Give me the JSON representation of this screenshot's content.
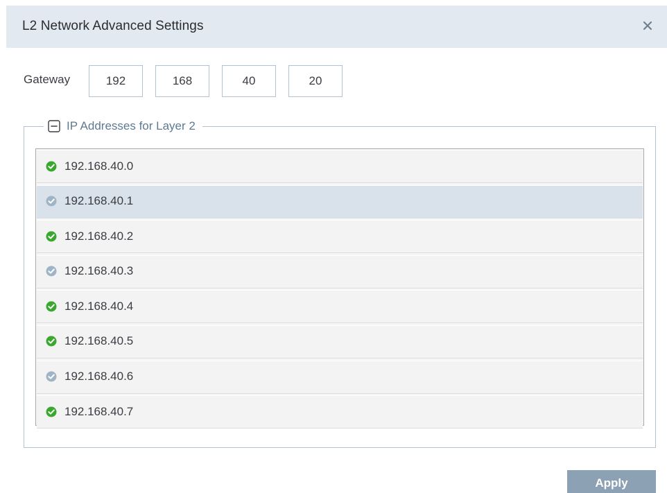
{
  "dialog": {
    "title": "L2 Network Advanced Settings",
    "close_icon": "close-icon"
  },
  "gateway": {
    "label": "Gateway",
    "octets": [
      "192",
      "168",
      "40",
      "20"
    ]
  },
  "ip_group": {
    "legend": "IP Addresses for Layer 2",
    "toggle_icon": "collapse-minus-icon",
    "items": [
      {
        "ip": "192.168.40.0",
        "status": "active",
        "status_color": "#3aa72f",
        "selected": false
      },
      {
        "ip": "192.168.40.1",
        "status": "inactive",
        "status_color": "#9fb4c6",
        "selected": true
      },
      {
        "ip": "192.168.40.2",
        "status": "active",
        "status_color": "#3aa72f",
        "selected": false
      },
      {
        "ip": "192.168.40.3",
        "status": "inactive",
        "status_color": "#9fb4c6",
        "selected": false
      },
      {
        "ip": "192.168.40.4",
        "status": "active",
        "status_color": "#3aa72f",
        "selected": false
      },
      {
        "ip": "192.168.40.5",
        "status": "active",
        "status_color": "#3aa72f",
        "selected": false
      },
      {
        "ip": "192.168.40.6",
        "status": "inactive",
        "status_color": "#9fb4c6",
        "selected": false
      },
      {
        "ip": "192.168.40.7",
        "status": "active",
        "status_color": "#3aa72f",
        "selected": false
      }
    ]
  },
  "actions": {
    "apply_label": "Apply",
    "apply_color": "#8ca1b3"
  }
}
